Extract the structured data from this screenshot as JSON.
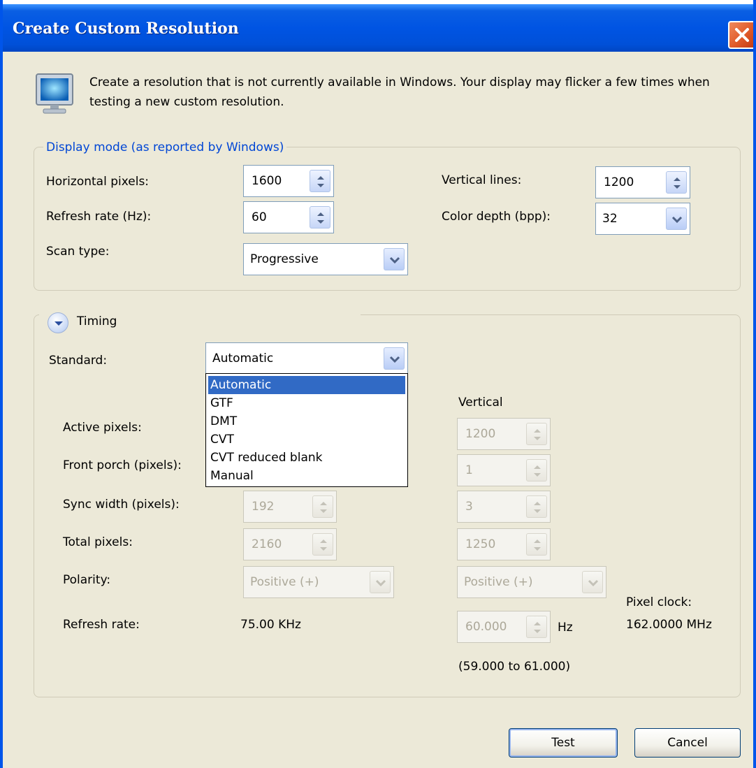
{
  "window": {
    "title": "Create Custom Resolution"
  },
  "intro_text": "Create a resolution that is not currently available in Windows. Your display may flicker a few times when testing a new custom resolution.",
  "display_mode": {
    "group_title": "Display mode (as reported by Windows)",
    "horizontal_pixels": {
      "label": "Horizontal pixels:",
      "value": "1600"
    },
    "vertical_lines": {
      "label": "Vertical lines:",
      "value": "1200"
    },
    "refresh_rate": {
      "label": "Refresh rate (Hz):",
      "value": "60"
    },
    "color_depth": {
      "label": "Color depth (bpp):",
      "value": "32"
    },
    "scan_type": {
      "label": "Scan type:",
      "value": "Progressive"
    }
  },
  "timing": {
    "toggle_label": "Timing",
    "standard_label": "Standard:",
    "standard_value": "Automatic",
    "standard_options": [
      "Automatic",
      "GTF",
      "DMT",
      "CVT",
      "CVT reduced blank",
      "Manual"
    ],
    "vertical_header": "Vertical",
    "rows": {
      "active_pixels": {
        "label": "Active pixels:",
        "vertical": "1200"
      },
      "front_porch": {
        "label": "Front porch (pixels):",
        "vertical": "1"
      },
      "sync_width": {
        "label": "Sync width (pixels):",
        "horizontal": "192",
        "vertical": "3"
      },
      "total_pixels": {
        "label": "Total pixels:",
        "horizontal": "2160",
        "vertical": "1250"
      },
      "polarity": {
        "label": "Polarity:",
        "horizontal": "Positive (+)",
        "vertical": "Positive (+)"
      },
      "refresh_rate": {
        "label": "Refresh rate:",
        "horizontal": "75.00 KHz",
        "vertical": "60.000",
        "unit": "Hz"
      }
    },
    "range_text": "(59.000 to 61.000)",
    "pixel_clock_label": "Pixel clock:",
    "pixel_clock_value": "162.0000 MHz"
  },
  "buttons": {
    "test": "Test",
    "cancel": "Cancel"
  }
}
